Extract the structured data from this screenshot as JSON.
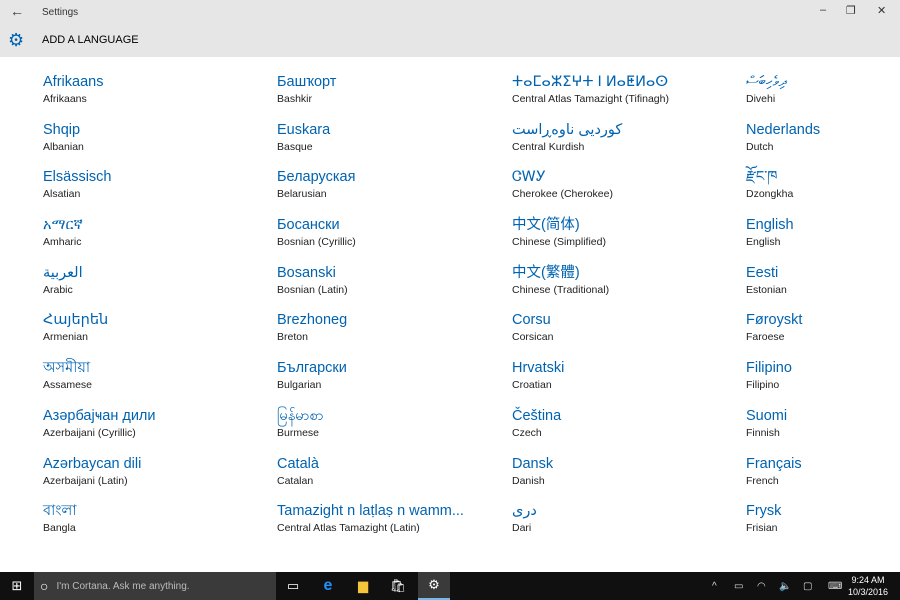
{
  "window": {
    "title": "Settings",
    "back_icon": "back-arrow-icon",
    "minimize": "–",
    "maximize": "❐",
    "close": "✕"
  },
  "page": {
    "title": "ADD A LANGUAGE",
    "icon": "gear-icon"
  },
  "languages": [
    {
      "native": "Afrikaans",
      "english": "Afrikaans"
    },
    {
      "native": "Башҡорт",
      "english": "Bashkir"
    },
    {
      "native": "ⵜⴰⵎⴰⵣⵉⵖⵜ ⵏ ⵍⴰⵟⵍⴰⵙ",
      "english": "Central Atlas Tamazight (Tifinagh)"
    },
    {
      "native": "ދިވެހިބަސް",
      "english": "Divehi"
    },
    {
      "native": "Shqip",
      "english": "Albanian"
    },
    {
      "native": "Euskara",
      "english": "Basque"
    },
    {
      "native": "کوردیی ناوەڕاست",
      "english": "Central Kurdish"
    },
    {
      "native": "Nederlands",
      "english": "Dutch"
    },
    {
      "native": "Elsässisch",
      "english": "Alsatian"
    },
    {
      "native": "Беларуская",
      "english": "Belarusian"
    },
    {
      "native": "ᏣᎳᎩ",
      "english": "Cherokee (Cherokee)"
    },
    {
      "native": "རྫོང་ཁ",
      "english": "Dzongkha"
    },
    {
      "native": "አማርኛ",
      "english": "Amharic"
    },
    {
      "native": "Босански",
      "english": "Bosnian (Cyrillic)"
    },
    {
      "native": "中文(简体)",
      "english": "Chinese (Simplified)"
    },
    {
      "native": "English",
      "english": "English"
    },
    {
      "native": "العربية",
      "english": "Arabic"
    },
    {
      "native": "Bosanski",
      "english": "Bosnian (Latin)"
    },
    {
      "native": "中文(繁體)",
      "english": "Chinese (Traditional)"
    },
    {
      "native": "Eesti",
      "english": "Estonian"
    },
    {
      "native": "Հայերեն",
      "english": "Armenian"
    },
    {
      "native": "Brezhoneg",
      "english": "Breton"
    },
    {
      "native": "Corsu",
      "english": "Corsican"
    },
    {
      "native": "Føroyskt",
      "english": "Faroese"
    },
    {
      "native": "অসমীয়া",
      "english": "Assamese"
    },
    {
      "native": "Български",
      "english": "Bulgarian"
    },
    {
      "native": "Hrvatski",
      "english": "Croatian"
    },
    {
      "native": "Filipino",
      "english": "Filipino"
    },
    {
      "native": "Азәрбајҹан дили",
      "english": "Azerbaijani (Cyrillic)"
    },
    {
      "native": "မြန်မာစာ",
      "english": "Burmese"
    },
    {
      "native": "Čeština",
      "english": "Czech"
    },
    {
      "native": "Suomi",
      "english": "Finnish"
    },
    {
      "native": "Azərbaycan dili",
      "english": "Azerbaijani (Latin)"
    },
    {
      "native": "Català",
      "english": "Catalan"
    },
    {
      "native": "Dansk",
      "english": "Danish"
    },
    {
      "native": "Français",
      "english": "French"
    },
    {
      "native": "বাংলা",
      "english": "Bangla"
    },
    {
      "native": "Tamazight n laṭlaṣ n wamm...",
      "english": "Central Atlas Tamazight (Latin)"
    },
    {
      "native": "دری",
      "english": "Dari"
    },
    {
      "native": "Frysk",
      "english": "Frisian"
    }
  ],
  "taskbar": {
    "cortana_placeholder": "I'm Cortana. Ask me anything.",
    "time": "9:24 AM",
    "date": "10/3/2016"
  }
}
